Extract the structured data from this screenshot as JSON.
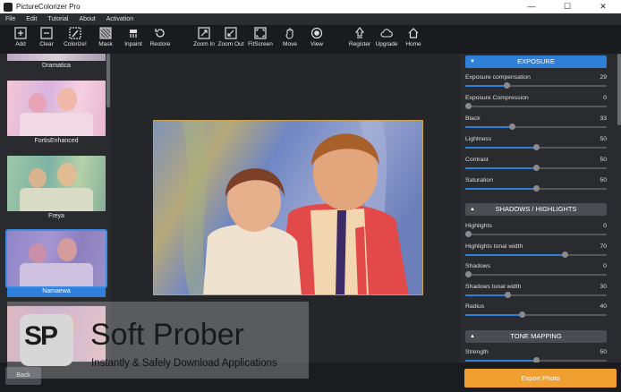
{
  "window": {
    "title": "PictureColorizer Pro",
    "buttons": [
      "—",
      "☐",
      "✕"
    ]
  },
  "menu": [
    "File",
    "Edit",
    "Tutorial",
    "About",
    "Activation"
  ],
  "toolbar": {
    "add": "Add",
    "clear": "Clear",
    "colorize": "Colorize!",
    "mask": "Mask",
    "inpaint": "Inpaint",
    "restore": "Restore",
    "zoom_in": "Zoom In",
    "zoom_out": "Zoom Out",
    "fitscreen": "FitScreen",
    "move": "Move",
    "view": "View",
    "register": "Register",
    "upgrade": "Upgrade",
    "home": "Home"
  },
  "presets": [
    {
      "name": "Dramatica"
    },
    {
      "name": "FortisEnhanced"
    },
    {
      "name": "Freya"
    },
    {
      "name": "Namaewa",
      "selected": true
    }
  ],
  "bottom": {
    "back": "Back",
    "export": "Export Photo"
  },
  "watermark": {
    "logo_text": "SP",
    "title": "Soft Prober",
    "subtitle": "Instantly & Safely Download Applications"
  },
  "panel": {
    "exposure": {
      "header": "EXPOSURE",
      "params": [
        {
          "label": "Exposure compensation",
          "value": "29",
          "fraction": 0.29
        },
        {
          "label": "Exposure Compression",
          "value": "0",
          "fraction": 0.0
        },
        {
          "label": "Black",
          "value": "33",
          "fraction": 0.33
        },
        {
          "label": "Lightness",
          "value": "50",
          "fraction": 0.5
        },
        {
          "label": "Contrast",
          "value": "50",
          "fraction": 0.5
        },
        {
          "label": "Saturation",
          "value": "50",
          "fraction": 0.5
        }
      ]
    },
    "shadows": {
      "header": "SHADOWS / HIGHLIGHTS",
      "params": [
        {
          "label": "Highlights",
          "value": "0",
          "fraction": 0.0
        },
        {
          "label": "Highlights tonal width",
          "value": "70",
          "fraction": 0.7
        },
        {
          "label": "Shadows",
          "value": "0",
          "fraction": 0.0
        },
        {
          "label": "Shadows tonal width",
          "value": "30",
          "fraction": 0.3
        },
        {
          "label": "Radius",
          "value": "40",
          "fraction": 0.4
        }
      ]
    },
    "tone": {
      "header": "TONE MAPPING",
      "params": [
        {
          "label": "Strength",
          "value": "50",
          "fraction": 0.5
        }
      ]
    }
  },
  "colors": {
    "accent": "#2e7fd8",
    "export": "#f0a030",
    "photo_border": "#caa24a"
  }
}
